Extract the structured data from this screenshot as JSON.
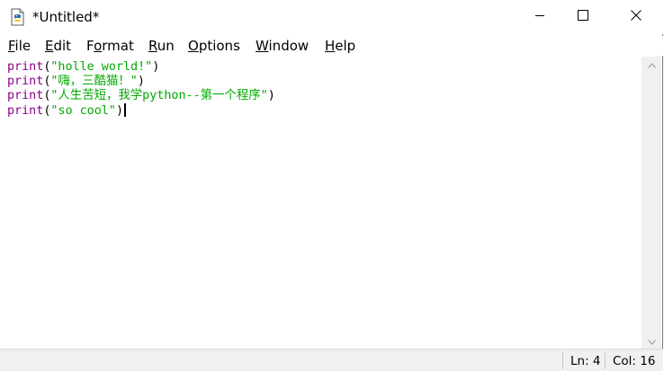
{
  "window": {
    "title": "*Untitled*",
    "minimize_icon": "minimize-icon",
    "maximize_icon": "maximize-icon",
    "close_icon": "close-icon",
    "app_icon": "idle-file-icon"
  },
  "menu": {
    "items": [
      {
        "mnemonic": "F",
        "rest": "ile"
      },
      {
        "mnemonic": "E",
        "rest": "dit"
      },
      {
        "pre": "F",
        "mnemonic": "o",
        "rest": "rmat"
      },
      {
        "mnemonic": "R",
        "rest": "un"
      },
      {
        "mnemonic": "O",
        "rest": "ptions"
      },
      {
        "mnemonic": "W",
        "rest": "indow"
      },
      {
        "mnemonic": "H",
        "rest": "elp"
      }
    ]
  },
  "editor": {
    "lines": [
      {
        "keyword": "print",
        "open": "(",
        "string": "\"holle world!\"",
        "close": ")"
      },
      {
        "keyword": "print",
        "open": "(",
        "string": "\"嗨，三酷猫！\"",
        "close": ")"
      },
      {
        "keyword": "print",
        "open": "(",
        "string": "\"人生苦短，我学python--第一个程序\"",
        "close": ")"
      },
      {
        "keyword": "print",
        "open": "(",
        "string": "\"so cool\"",
        "close": ")"
      }
    ],
    "colors": {
      "keyword": "#900090",
      "string": "#00aa00",
      "text": "#000000"
    }
  },
  "status": {
    "line": "Ln: 4",
    "col": "Col: 16"
  }
}
